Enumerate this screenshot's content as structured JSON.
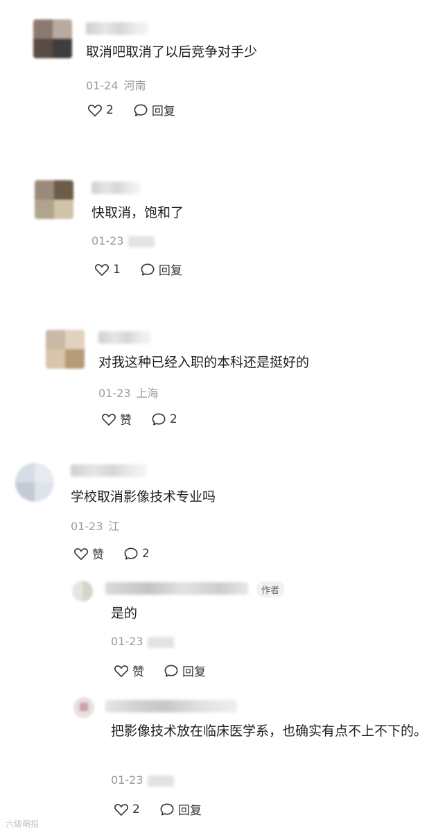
{
  "comments": [
    {
      "text": "取消吧取消了以后竞争对手少",
      "date": "01-24",
      "location": "河南",
      "likes": "2",
      "reply": "回复"
    },
    {
      "text": "快取消，饱和了",
      "date": "01-23",
      "location": "",
      "likes": "1",
      "reply": "回复"
    },
    {
      "text": "对我这种已经入职的本科还是挺好的",
      "date": "01-23",
      "location": "上海",
      "likes": "赞",
      "reply": "2"
    },
    {
      "text": "学校取消影像技术专业吗",
      "date": "01-23",
      "location": "江",
      "likes": "赞",
      "reply": "2"
    }
  ],
  "replies": [
    {
      "badge": "作者",
      "text": "是的",
      "date": "01-23",
      "likes": "赞",
      "reply": "回复"
    },
    {
      "text": "把影像技术放在临床医学系，也确实有点不上不下的。",
      "date": "01-23",
      "likes": "2",
      "reply": "回复"
    }
  ],
  "watermark": "六级萌招",
  "icons": {
    "like": "heart-outline-icon",
    "reply": "speech-bubble-icon"
  }
}
